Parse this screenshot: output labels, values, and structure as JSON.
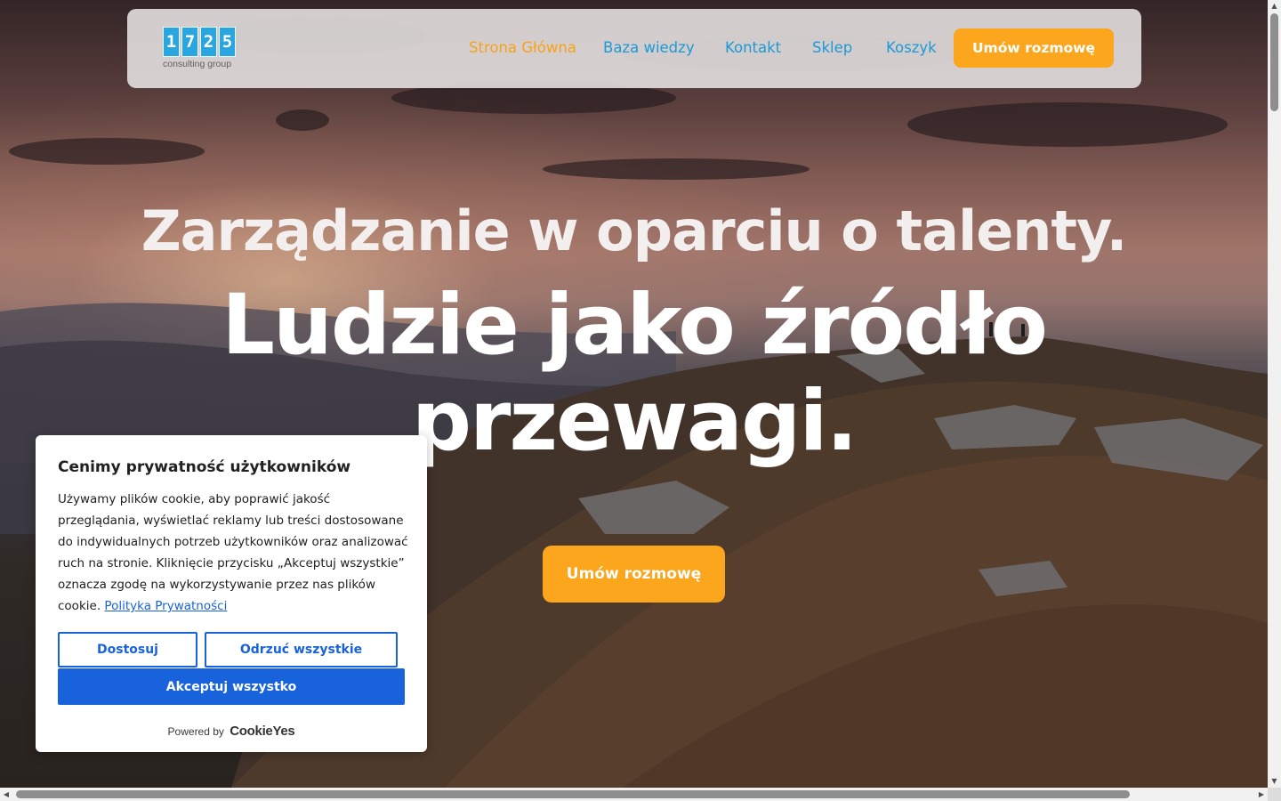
{
  "header": {
    "logo_digits": [
      "1",
      "7",
      "2",
      "5"
    ],
    "logo_tagline": "consulting group",
    "nav": [
      {
        "label": "Strona Główna",
        "active": true
      },
      {
        "label": "Baza wiedzy",
        "active": false
      },
      {
        "label": "Kontakt",
        "active": false
      },
      {
        "label": "Sklep",
        "active": false
      },
      {
        "label": "Koszyk",
        "active": false
      }
    ],
    "cta_label": "Umów rozmowę"
  },
  "hero": {
    "headline": "Zarządzanie w oparciu o talenty.",
    "subheadline": "Ludzie jako źródło przewagi.",
    "cta_label": "Umów rozmowę"
  },
  "cookie_banner": {
    "title": "Cenimy prywatność użytkowników",
    "body": "Używamy plików cookie, aby poprawić jakość przeglądania, wyświetlać reklamy lub treści dostosowane do indywidualnych potrzeb użytkowników oraz analizować ruch na stronie. Kliknięcie przycisku „Akceptuj wszystkie” oznacza zgodę na wykorzystywanie przez nas plików cookie.",
    "policy_link": "Polityka Prywatności",
    "customize_label": "Dostosuj",
    "reject_label": "Odrzuć wszystkie",
    "accept_label": "Akceptuj wszystko",
    "powered_by": "Powered by",
    "powered_brand": "CookieYes"
  },
  "colors": {
    "accent_orange": "#fca61d",
    "nav_blue": "#1c9ad6",
    "cookie_blue": "#1863dc"
  }
}
